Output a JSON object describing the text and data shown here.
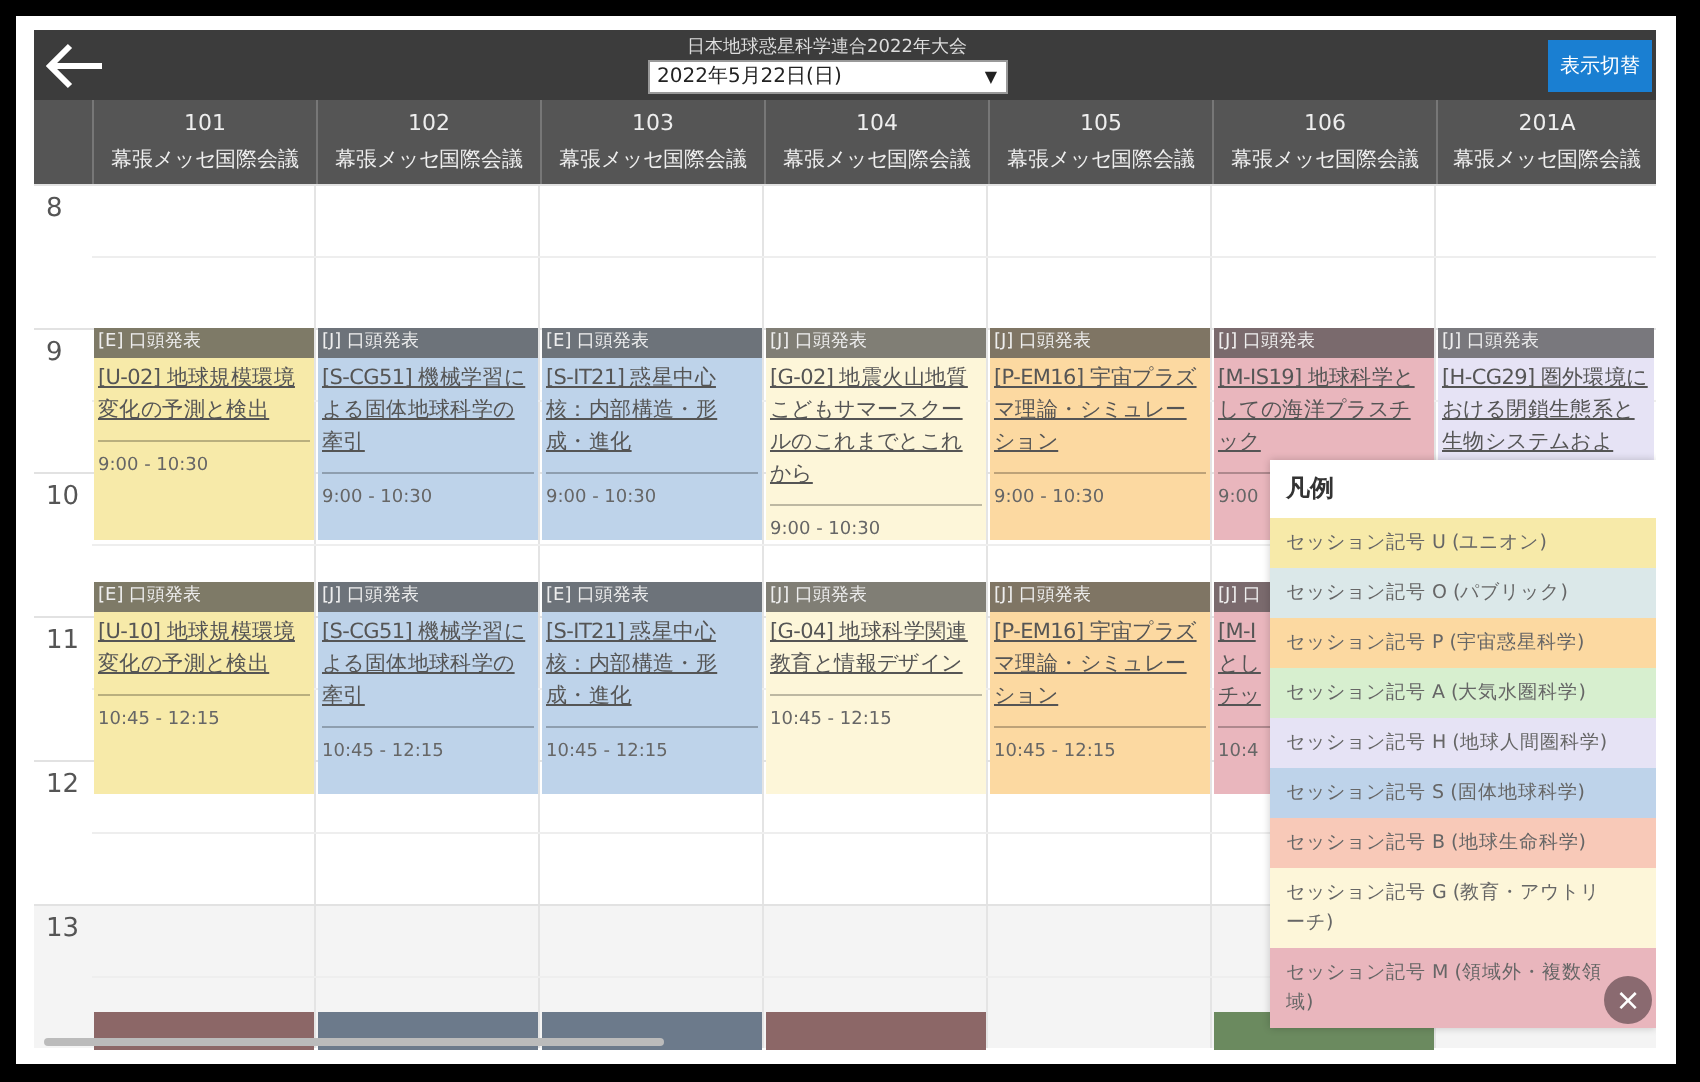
{
  "top_bar": {
    "title": "日本地球惑星科学連合2022年大会",
    "date_select": "2022年5月22日(日)",
    "date_caret": "▼",
    "toggle_button": "表示切替"
  },
  "hours": [
    "8",
    "9",
    "10",
    "11",
    "12",
    "13"
  ],
  "columns": [
    {
      "room": "101",
      "venue": "幕張メッセ国際会議",
      "sessions": [
        {
          "lang": "[E] 口頭発表",
          "title": "[U-02] 地球規模環境変化の予測と検出",
          "time": "9:00 - 10:30",
          "color": "#f7eaa9"
        },
        {
          "lang": "[E] 口頭発表",
          "title": "[U-10] 地球規模環境変化の予測と検出",
          "time": "10:45 - 12:15",
          "color": "#f7eaa9"
        }
      ],
      "next": {
        "color": "#8c6767"
      }
    },
    {
      "room": "102",
      "venue": "幕張メッセ国際会議",
      "sessions": [
        {
          "lang": "[J] 口頭発表",
          "title": "[S-CG51] 機械学習による固体地球科学の牽引",
          "time": "9:00 - 10:30",
          "color": "#bed3ea"
        },
        {
          "lang": "[J] 口頭発表",
          "title": "[S-CG51] 機械学習による固体地球科学の牽引",
          "time": "10:45 - 12:15",
          "color": "#bed3ea"
        }
      ],
      "next": {
        "color": "#6c7a8b"
      }
    },
    {
      "room": "103",
      "venue": "幕張メッセ国際会議",
      "sessions": [
        {
          "lang": "[E] 口頭発表",
          "title": "[S-IT21] 惑星中心核：内部構造・形成・進化",
          "time": "9:00 - 10:30",
          "color": "#bed3ea"
        },
        {
          "lang": "[E] 口頭発表",
          "title": "[S-IT21] 惑星中心核：内部構造・形成・進化",
          "time": "10:45 - 12:15",
          "color": "#bed3ea"
        }
      ],
      "next": {
        "color": "#6c7a8b"
      }
    },
    {
      "room": "104",
      "venue": "幕張メッセ国際会議",
      "sessions": [
        {
          "lang": "[J] 口頭発表",
          "title": "[G-02] 地震火山地質こどもサマースクールのこれまでとこれから",
          "time": "9:00 - 10:30",
          "color": "#fdf6d9"
        },
        {
          "lang": "[J] 口頭発表",
          "title": "[G-04] 地球科学関連教育と情報デザイン",
          "time": "10:45 - 12:15",
          "color": "#fdf6d9"
        }
      ],
      "next": {
        "color": "#8c6767"
      }
    },
    {
      "room": "105",
      "venue": "幕張メッセ国際会議",
      "sessions": [
        {
          "lang": "[J] 口頭発表",
          "title": "[P-EM16] 宇宙プラズマ理論・シミュレーション",
          "time": "9:00 - 10:30",
          "color": "#fcd9a1"
        },
        {
          "lang": "[J] 口頭発表",
          "title": "[P-EM16] 宇宙プラズマ理論・シミュレーション",
          "time": "10:45 - 12:15",
          "color": "#fcd9a1"
        }
      ]
    },
    {
      "room": "106",
      "venue": "幕張メッセ国際会議",
      "sessions": [
        {
          "lang": "[J] 口頭発表",
          "title": "[M-IS19] 地球科学としての海洋プラスチック",
          "time": "9:00",
          "color": "#e9b6bd"
        },
        {
          "lang": "[J] 口",
          "title_lines": [
            "[M-I",
            "とし",
            "チッ"
          ],
          "time": "10:4",
          "color": "#e9b6bd"
        }
      ],
      "next": {
        "color": "#6b8a5f"
      }
    },
    {
      "room": "201A",
      "venue": "幕張メッセ国際会議",
      "sessions": [
        {
          "lang": "[J] 口頭発表",
          "title": "[H-CG29] 圏外環境における閉鎖生態系と生物システムおよ",
          "color": "#e6e3f5"
        }
      ]
    }
  ],
  "legend": {
    "title": "凡例",
    "items": [
      {
        "label": "セッション記号 U (ユニオン)",
        "color": "#f7eaa9"
      },
      {
        "label": "セッション記号 O (パブリック)",
        "color": "#dbe8e9"
      },
      {
        "label": "セッション記号 P (宇宙惑星科学)",
        "color": "#fcd9a1"
      },
      {
        "label": "セッション記号 A (大気水圏科学)",
        "color": "#d7efcf"
      },
      {
        "label": "セッション記号 H (地球人間圏科学)",
        "color": "#e6e3f5"
      },
      {
        "label": "セッション記号 S (固体地球科学)",
        "color": "#bed3ea"
      },
      {
        "label": "セッション記号 B (地球生命科学)",
        "color": "#f8c9b8"
      },
      {
        "label": "セッション記号 G (教育・アウトリーチ)",
        "color": "#fdf6d9"
      },
      {
        "label": "セッション記号 M (領域外・複数領域)",
        "color": "#e9b6bd"
      }
    ],
    "close": "×"
  }
}
